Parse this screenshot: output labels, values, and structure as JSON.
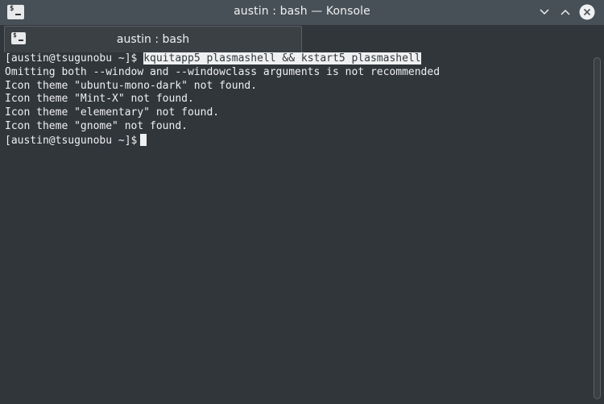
{
  "window": {
    "title": "austin : bash — Konsole",
    "app_icon": "terminal-icon",
    "app_icon_glyph": "$",
    "buttons": {
      "minimize": "chevron-down-icon",
      "maximize": "chevron-up-icon",
      "close": "close-icon"
    }
  },
  "tabs": [
    {
      "label": "austin : bash",
      "icon": "terminal-icon",
      "icon_glyph": "$"
    }
  ],
  "terminal": {
    "prompt": "[austin@tsugunobu ~]$",
    "command": "kquitapp5 plasmashell && kstart5 plasmashell",
    "output": [
      "Omitting both --window and --windowclass arguments is not recommended",
      "Icon theme \"ubuntu-mono-dark\" not found.",
      "Icon theme \"Mint-X\" not found.",
      "Icon theme \"elementary\" not found.",
      "Icon theme \"gnome\" not found."
    ],
    "final_prompt": "[austin@tsugunobu ~]$"
  },
  "colors": {
    "titlebar": "#475057",
    "background": "#31363b",
    "foreground": "#eff0f1"
  }
}
